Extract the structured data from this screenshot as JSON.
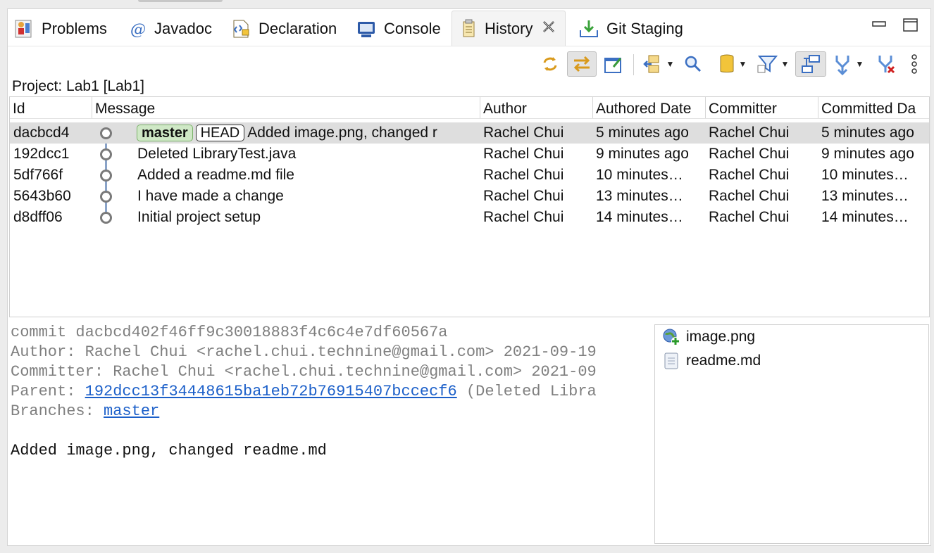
{
  "tabs": [
    {
      "label": "Problems",
      "icon": "problems-icon",
      "active": false
    },
    {
      "label": "Javadoc",
      "icon": "javadoc-icon",
      "active": false
    },
    {
      "label": "Declaration",
      "icon": "declaration-icon",
      "active": false
    },
    {
      "label": "Console",
      "icon": "console-icon",
      "active": false
    },
    {
      "label": "History",
      "icon": "history-icon",
      "active": true
    },
    {
      "label": "Git Staging",
      "icon": "git-staging-icon",
      "active": false
    }
  ],
  "project_label": "Project: Lab1 [Lab1]",
  "table": {
    "columns": [
      "Id",
      "Message",
      "Author",
      "Authored Date",
      "Committer",
      "Committed Da"
    ],
    "rows": [
      {
        "id": "dacbcd4",
        "branch": "master",
        "head": "HEAD",
        "message": "Added image.png, changed r",
        "author": "Rachel Chui",
        "authored": "5 minutes ago",
        "committer": "Rachel Chui",
        "committed": "5 minutes ago"
      },
      {
        "id": "192dcc1",
        "message": "Deleted LibraryTest.java",
        "author": "Rachel Chui",
        "authored": "9 minutes ago",
        "committer": "Rachel Chui",
        "committed": "9 minutes ago"
      },
      {
        "id": "5df766f",
        "message": "Added a readme.md file",
        "author": "Rachel Chui",
        "authored": "10 minutes…",
        "committer": "Rachel Chui",
        "committed": "10 minutes…"
      },
      {
        "id": "5643b60",
        "message": "I have made a change",
        "author": "Rachel Chui",
        "authored": "13 minutes…",
        "committer": "Rachel Chui",
        "committed": "13 minutes…"
      },
      {
        "id": "d8dff06",
        "message": "Initial project setup",
        "author": "Rachel Chui",
        "authored": "14 minutes…",
        "committer": "Rachel Chui",
        "committed": "14 minutes…"
      }
    ]
  },
  "details": {
    "commit": "commit dacbcd402f46ff9c30018883f4c6c4e7df60567a",
    "author": "Author: Rachel Chui <rachel.chui.technine@gmail.com> 2021-09-19",
    "committer": "Committer: Rachel Chui <rachel.chui.technine@gmail.com> 2021-09",
    "parent_label": "Parent: ",
    "parent_hash": "192dcc13f34448615ba1eb72b76915407bccecf6",
    "parent_suffix": " (Deleted Libra",
    "branches_label": "Branches: ",
    "branches_link": "master",
    "message": "Added image.png, changed readme.md"
  },
  "files": [
    {
      "name": "image.png",
      "icon": "image-file-added-icon"
    },
    {
      "name": "readme.md",
      "icon": "text-file-icon"
    }
  ]
}
